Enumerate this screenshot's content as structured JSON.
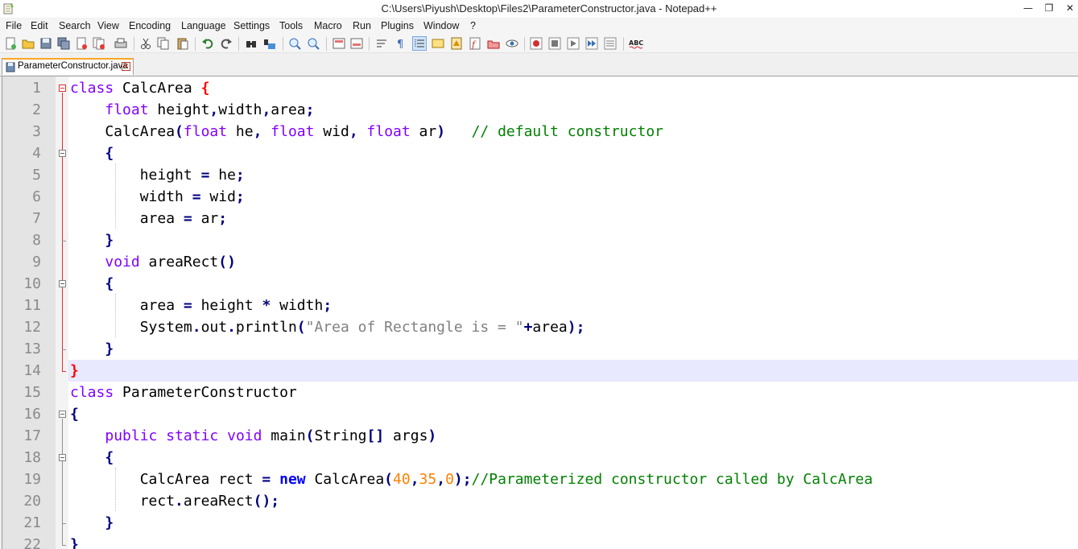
{
  "window": {
    "title": "C:\\Users\\Piyush\\Desktop\\Files2\\ParameterConstructor.java - Notepad++",
    "minimize": "—",
    "restore": "❐",
    "close": "✕"
  },
  "menu": [
    "File",
    "Edit",
    "Search",
    "View",
    "Encoding",
    "Language",
    "Settings",
    "Tools",
    "Macro",
    "Run",
    "Plugins",
    "Window",
    "?"
  ],
  "tab": {
    "label": "ParameterConstructor.java",
    "close": "✕"
  },
  "toolbar_icons": [
    "new-file-icon",
    "open-file-icon",
    "save-icon",
    "save-all-icon",
    "close-icon",
    "close-all-icon",
    "print-icon",
    "cut-icon",
    "copy-icon",
    "paste-icon",
    "undo-icon",
    "redo-icon",
    "find-icon",
    "replace-icon",
    "zoom-in-icon",
    "zoom-out-icon",
    "sync-v-icon",
    "sync-h-icon",
    "word-wrap-icon",
    "show-all-chars-icon",
    "indent-guide-icon",
    "user-lang-icon",
    "doc-map-icon",
    "function-list-icon",
    "folder-workspace-icon",
    "monitor-icon",
    "record-macro-icon",
    "stop-record-icon",
    "play-macro-icon",
    "run-macro-multiple-icon",
    "save-macro-icon",
    "spellcheck-icon"
  ],
  "toolbar": {
    "spellcheck_label": "ABC"
  },
  "editor": {
    "line_numbers": [
      "1",
      "2",
      "3",
      "4",
      "5",
      "6",
      "7",
      "8",
      "9",
      "10",
      "11",
      "12",
      "13",
      "14",
      "15",
      "16",
      "17",
      "18",
      "19",
      "20",
      "21",
      "22"
    ],
    "lines": [
      "class CalcArea {",
      "    float height,width,area;",
      "    CalcArea(float he, float wid, float ar)   // default constructor",
      "    {",
      "        height = he;",
      "        width = wid;",
      "        area = ar;",
      "    }",
      "    void areaRect()",
      "    {",
      "        area = height * width;",
      "        System.out.println(\"Area of Rectangle is = \"+area);",
      "    }",
      "}",
      "class ParameterConstructor",
      "{",
      "    public static void main(String[] args)",
      "    {",
      "        CalcArea rect = new CalcArea(40,35,0);//Parameterized constructor called by CalcArea",
      "        rect.areaRect();",
      "    }",
      "}"
    ]
  },
  "colors": {
    "keyword": "#8000ff",
    "operator": "#000080",
    "string": "#808080",
    "number": "#ff8000",
    "comment": "#008000",
    "brace_match": "#ff0000",
    "current_line": "#e8e8ff"
  }
}
